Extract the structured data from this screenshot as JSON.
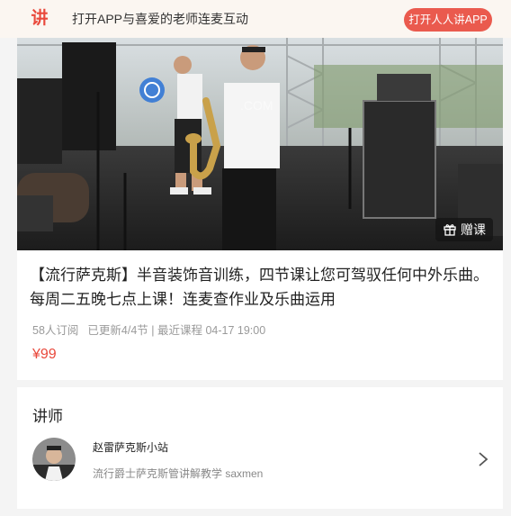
{
  "app_banner": {
    "logo_char": "讲",
    "promo_text": "打开APP与喜爱的老师连麦互动",
    "open_button_label": "打开人人讲APP"
  },
  "course": {
    "gift_button_label": "赠课",
    "title": "【流行萨克斯】半音装饰音训练，四节课让您可驾驭任何中外乐曲。每周二五晚七点上课！连麦查作业及乐曲运用",
    "subscribers": "58人订阅",
    "update_status": "已更新4/4节 | 最近课程 04-17 19:00",
    "price": "¥99"
  },
  "teacher_section": {
    "title": "讲师",
    "name": "赵雷萨克斯小站",
    "description": "流行爵士萨克斯管讲解教学 saxmen"
  },
  "colors": {
    "accent": "#e9493c",
    "topbar_bg": "#fbf6f1",
    "page_bg": "#f4f4f4"
  },
  "icons": {
    "gift": "gift-icon",
    "chevron": "chevron-right-icon"
  }
}
